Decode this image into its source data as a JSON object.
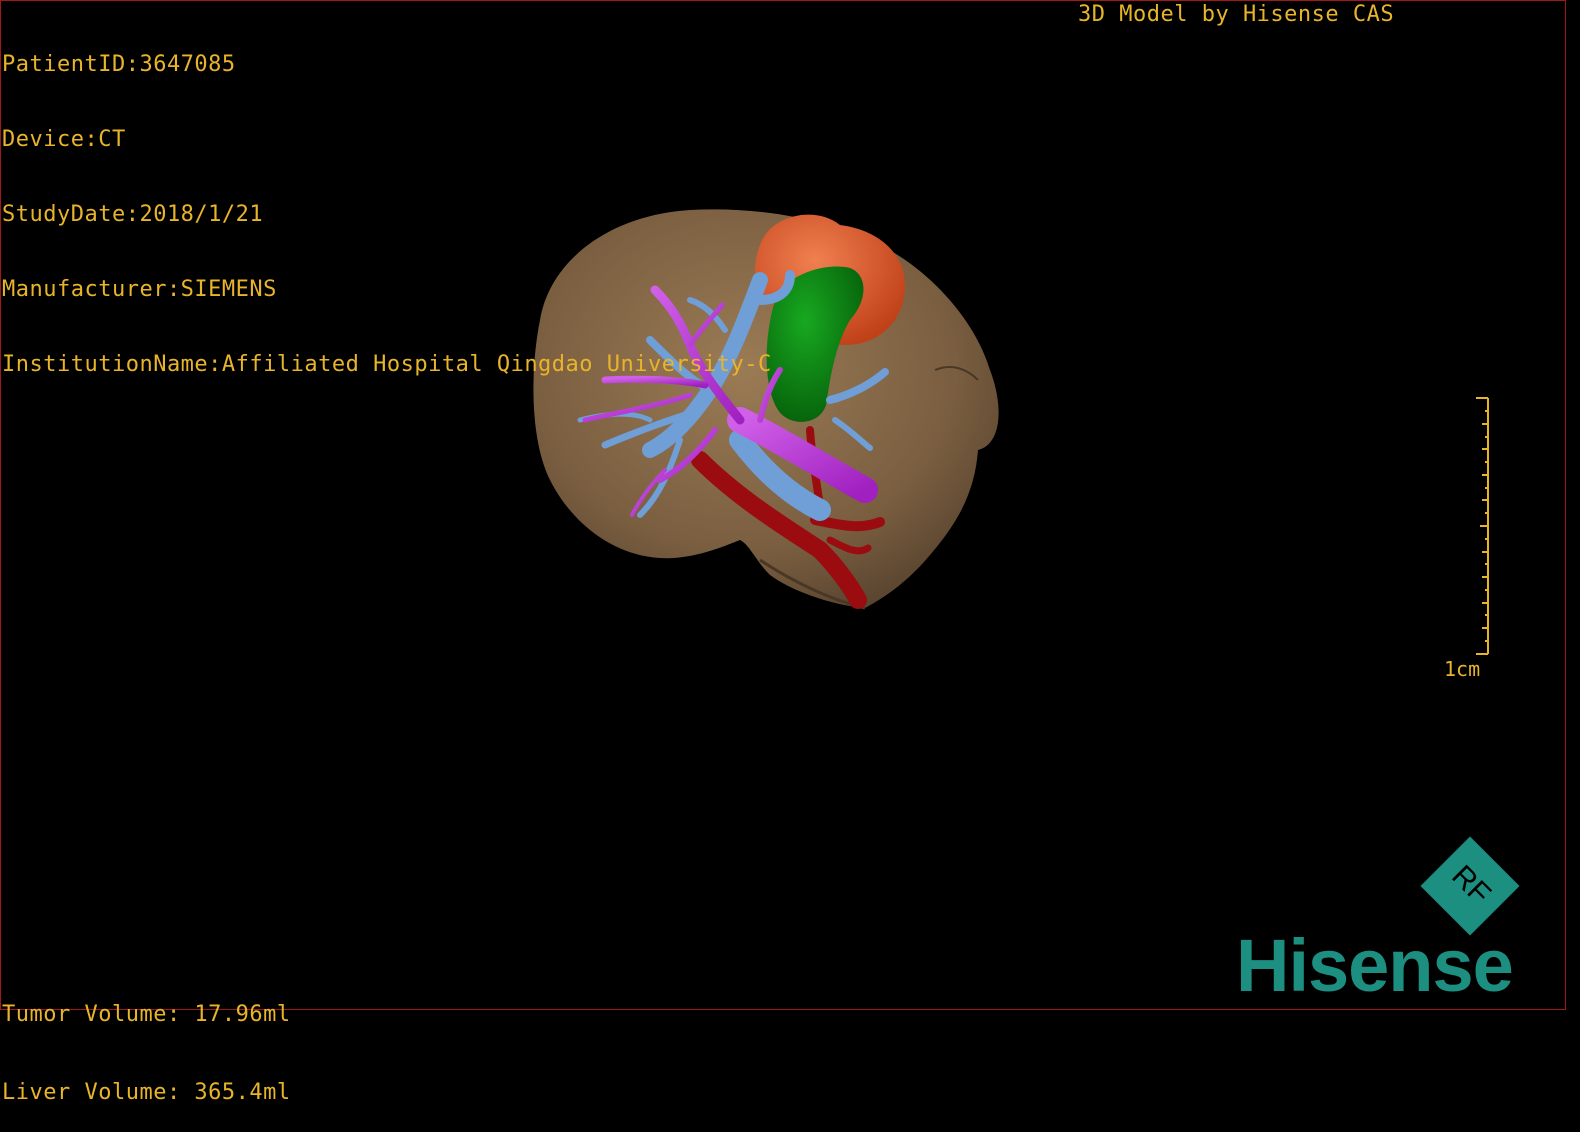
{
  "overlay": {
    "patient_id": "PatientID:3647085",
    "device": "Device:CT",
    "study_date": "StudyDate:2018/1/21",
    "manufacturer": "Manufacturer:SIEMENS",
    "institution": "InstitutionName:Affiliated Hospital Qingdao University-C",
    "model_credit": "3D Model by Hisense CAS"
  },
  "volumes": {
    "tumor": "Tumor Volume: 17.96ml",
    "liver": "Liver Volume: 365.4ml"
  },
  "scale": {
    "label": "1cm"
  },
  "logo": {
    "text": "Hisense",
    "diamond_text": "RF",
    "color": "#1c8f80"
  },
  "colors": {
    "text": "#e8b42a",
    "liver": "#8a6c4a",
    "tumor": "#e8643a",
    "gallbladder": "#0e8a14",
    "portal_vein": "#c43ad8",
    "hepatic_vein": "#6f9fd6",
    "artery": "#9a0c10"
  }
}
